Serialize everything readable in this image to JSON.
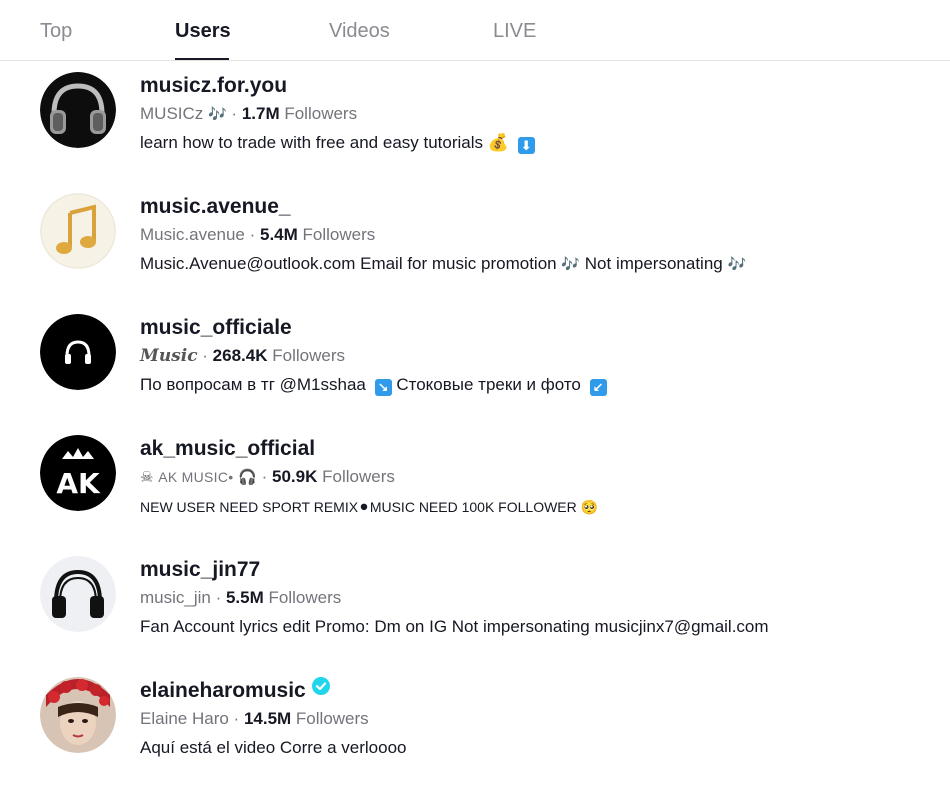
{
  "tabs": [
    {
      "label": "Top"
    },
    {
      "label": "Users"
    },
    {
      "label": "Videos"
    },
    {
      "label": "LIVE"
    }
  ],
  "active_tab": "Users",
  "followers_word": "Followers",
  "users": [
    {
      "username": "musicz.for.you",
      "nickname": "MUSICz",
      "nickname_emoji": "🎶",
      "followers": "1.7M",
      "bio": "learn how to trade with free and easy tutorials",
      "bio_emoji": "💰",
      "bio_arrow": "⬇"
    },
    {
      "username": "music.avenue_",
      "nickname": "Music.avenue",
      "followers": "5.4M",
      "bio": "Music.Avenue@outlook.com Email for music promotion",
      "bio_emoji_1": "🎶",
      "bio_tail": "Not impersonating",
      "bio_emoji_2": "🎶"
    },
    {
      "username": "music_officiale",
      "nickname": "Music",
      "followers": "268.4K",
      "bio_part1": "По вопросам в тг @M1sshaa",
      "bio_arrow_1": "↘",
      "bio_part2": "Стоковые треки и фото",
      "bio_arrow_2": "↙"
    },
    {
      "username": "ak_music_official",
      "nickname_prefix": "☠",
      "nickname": "AK MUSIC•",
      "nickname_emoji": "🎧",
      "followers": "50.9K",
      "bio_part1": "NEW USER NEED SPORT REMIX",
      "bio_dot": "⚫",
      "bio_part2": "MUSIC NEED 100K FOLLOWER",
      "bio_emoji": "🥺",
      "avatar_text": "AK"
    },
    {
      "username": "music_jin77",
      "nickname": "music_jin",
      "followers": "5.5M",
      "bio": "Fan Account lyrics edit Promo: Dm on IG Not impersonating musicjinx7@gmail.com"
    },
    {
      "username": "elaineharomusic",
      "verified": true,
      "nickname": "Elaine Haro",
      "followers": "14.5M",
      "bio": "Aquí está el video Corre a verloooo"
    }
  ],
  "colors": {
    "text": "#161823",
    "secondary": "#73747b",
    "tab_inactive": "#8a8b91",
    "verified": "#20d5ec",
    "arrow_box": "#2f9bea"
  }
}
